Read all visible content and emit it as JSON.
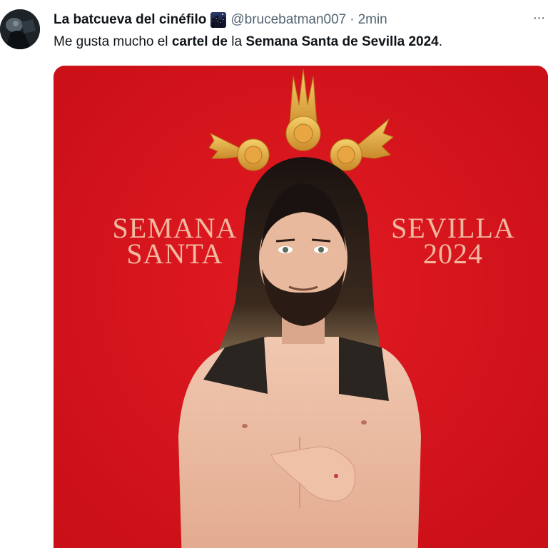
{
  "tweet": {
    "display_name": "La batcueva del cinéfilo",
    "name_emoji": "night-city-emoji",
    "handle": "@brucebatman007",
    "separator": "·",
    "time": "2min",
    "more_icon": "···",
    "text": {
      "part1": "Me gusta mucho el ",
      "part2_bold": "cartel de",
      "part3": " la ",
      "part4_bold": "Semana Santa de Sevilla 2024",
      "part5": "."
    }
  },
  "poster": {
    "left_line1": "SEMANA",
    "left_line2": "SANTA",
    "right_line1": "SEVILLA",
    "right_line2": "2024",
    "background_color": "#d8141c",
    "text_color": "#f1b8a0"
  }
}
